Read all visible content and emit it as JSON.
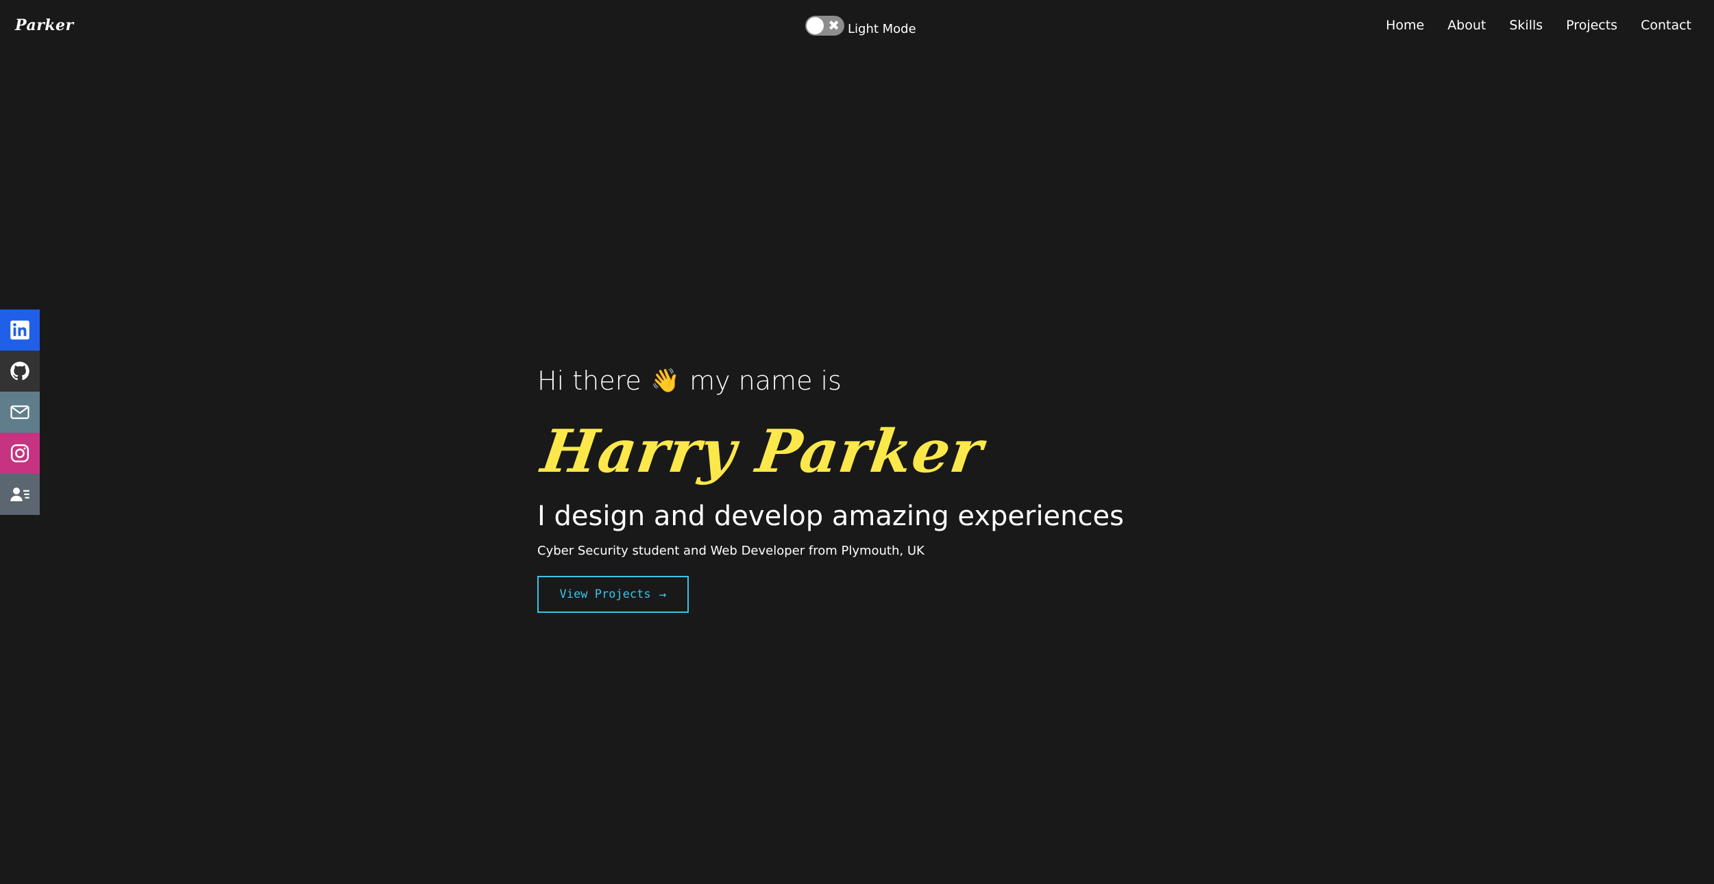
{
  "header": {
    "logo": "Parker",
    "mode_toggle_label": "Light Mode",
    "nav": [
      "Home",
      "About",
      "Skills",
      "Projects",
      "Contact"
    ]
  },
  "social": [
    {
      "icon": "linkedin-icon",
      "color": "#2060e8"
    },
    {
      "icon": "github-icon",
      "color": "#333333"
    },
    {
      "icon": "email-icon",
      "color": "#607d8b"
    },
    {
      "icon": "instagram-icon",
      "color": "#c63380"
    },
    {
      "icon": "resume-icon",
      "color": "#5b6670"
    }
  ],
  "hero": {
    "greeting_prefix": "Hi there",
    "wave_emoji": "👋",
    "greeting_suffix": "my name is",
    "name": "Harry Parker",
    "tagline": "I design and develop amazing experiences",
    "subtitle": "Cyber Security student and Web Developer from Plymouth, UK",
    "cta_label": "View Projects",
    "cta_arrow": "→"
  },
  "colors": {
    "background": "#191919",
    "name": "#fce84a",
    "accent": "#3bc4ea"
  }
}
